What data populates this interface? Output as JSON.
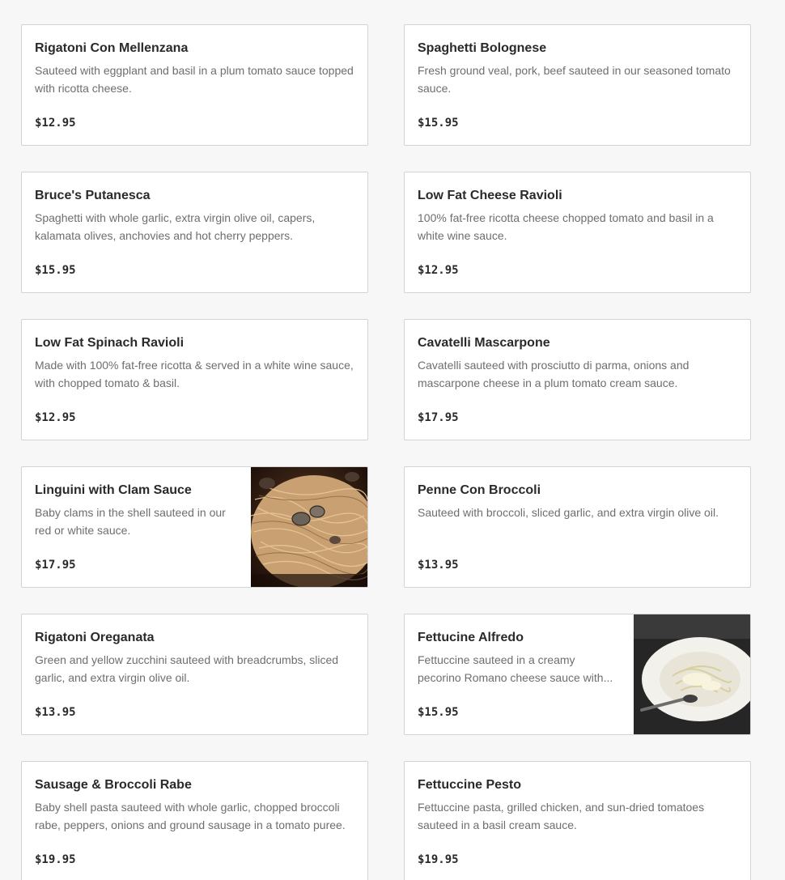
{
  "menu": {
    "items": [
      {
        "name": "Rigatoni Con Mellenzana",
        "description": "Sauteed with eggplant and basil in a plum tomato sauce topped with ricotta cheese.",
        "price": "$12.95"
      },
      {
        "name": "Spaghetti Bolognese",
        "description": "Fresh ground veal, pork, beef sauteed in our seasoned tomato sauce.",
        "price": "$15.95"
      },
      {
        "name": "Bruce's Putanesca",
        "description": "Spaghetti with whole garlic, extra virgin olive oil, capers, kalamata olives, anchovies and hot cherry peppers.",
        "price": "$15.95"
      },
      {
        "name": "Low Fat Cheese Ravioli",
        "description": "100% fat-free ricotta cheese chopped tomato and basil in a white wine sauce.",
        "price": "$12.95"
      },
      {
        "name": "Low Fat Spinach Ravioli",
        "description": "Made with 100% fat-free ricotta & served in a white wine sauce, with chopped tomato & basil.",
        "price": "$12.95"
      },
      {
        "name": "Cavatelli Mascarpone",
        "description": "Cavatelli sauteed with prosciutto di parma, onions and mascarpone cheese in a plum tomato cream sauce.",
        "price": "$17.95"
      },
      {
        "name": "Linguini with Clam Sauce",
        "description": "Baby clams in the shell sauteed in our red or white sauce.",
        "price": "$17.95",
        "photo": "linguini-clams-photo"
      },
      {
        "name": "Penne Con Broccoli",
        "description": "Sauteed with broccoli, sliced garlic, and extra virgin olive oil.",
        "price": "$13.95"
      },
      {
        "name": "Rigatoni Oreganata",
        "description": "Green and yellow zucchini sauteed with breadcrumbs, sliced garlic, and extra virgin olive oil.",
        "price": "$13.95"
      },
      {
        "name": "Fettucine Alfredo",
        "description": "Fettuccine sauteed in a creamy pecorino Romano cheese sauce with...",
        "price": "$15.95",
        "photo": "fettucine-alfredo-photo"
      },
      {
        "name": "Sausage & Broccoli Rabe",
        "description": "Baby shell pasta sauteed with whole garlic, chopped broccoli rabe, peppers, onions and ground sausage in a tomato puree.",
        "price": "$19.95"
      },
      {
        "name": "Fettuccine Pesto",
        "description": "Fettuccine pasta, grilled chicken, and sun-dried tomatoes sauteed in a basil cream sauce.",
        "price": "$19.95"
      }
    ]
  }
}
